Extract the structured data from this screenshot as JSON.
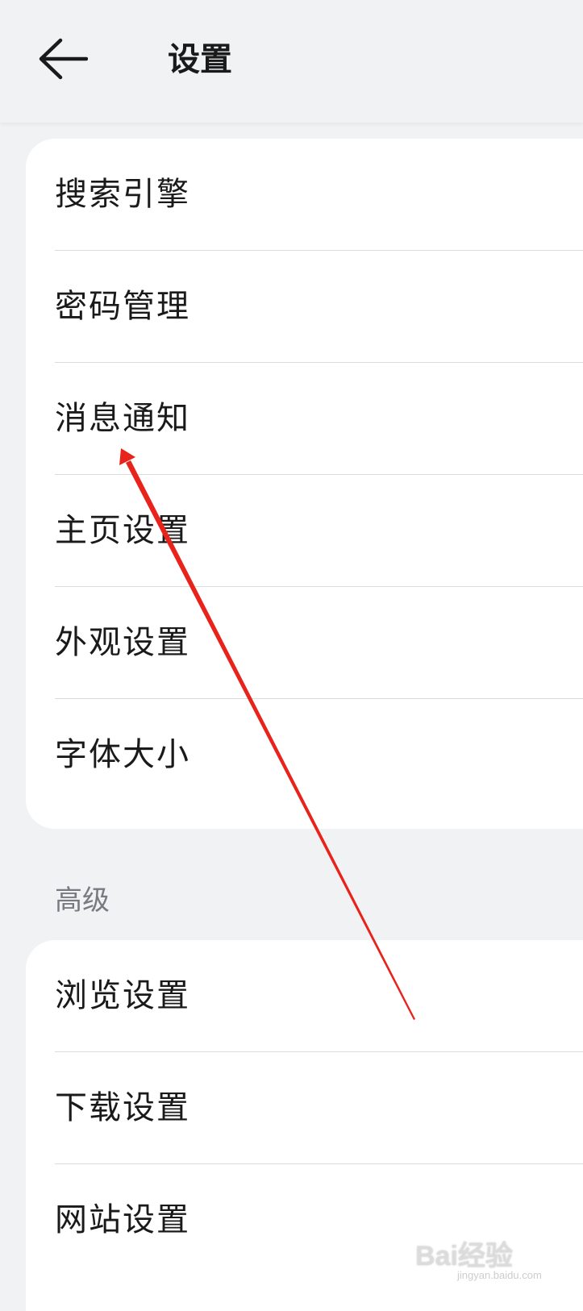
{
  "header": {
    "back_icon": "arrow-left-icon",
    "title": "设置"
  },
  "general": {
    "items": [
      {
        "label": "搜索引擎"
      },
      {
        "label": "密码管理"
      },
      {
        "label": "消息通知"
      },
      {
        "label": "主页设置"
      },
      {
        "label": "外观设置"
      },
      {
        "label": "字体大小"
      }
    ]
  },
  "advanced": {
    "section_title": "高级",
    "items": [
      {
        "label": "浏览设置"
      },
      {
        "label": "下载设置"
      },
      {
        "label": "网站设置"
      }
    ]
  },
  "annotation": {
    "type": "arrow",
    "color": "#e8231b",
    "target": "消息通知"
  },
  "watermark": {
    "brand": "Bai经验",
    "site": "jingyan.baidu.com"
  }
}
